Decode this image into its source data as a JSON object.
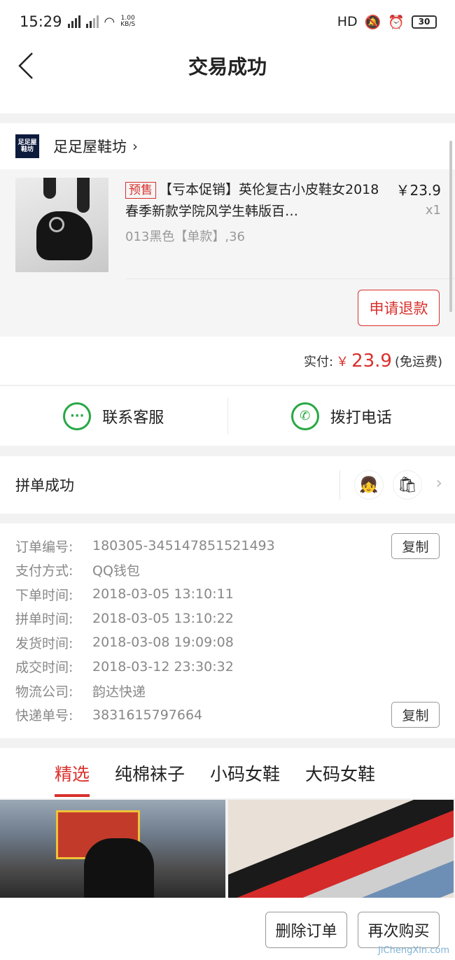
{
  "status_bar": {
    "time": "15:29",
    "net_speed": "1.00\nKB/S",
    "right": "HD",
    "battery": "30"
  },
  "nav": {
    "title": "交易成功"
  },
  "shop": {
    "logo_text": "足足屋\n鞋坊",
    "name": "足足屋鞋坊",
    "item": {
      "tag": "预售",
      "name": "【亏本促销】英伦复古小皮鞋女2018春季新款学院风学生韩版百…",
      "sku": "013黑色【单款】,36",
      "price": "￥23.9",
      "qty": "x1",
      "refund_label": "申请退款"
    }
  },
  "payment": {
    "label": "实付:",
    "currency": "￥",
    "amount": "23.9",
    "note": "(免运费)"
  },
  "contact": {
    "service_label": "联系客服",
    "phone_label": "拨打电话"
  },
  "group": {
    "label": "拼单成功"
  },
  "order_info": {
    "rows": [
      {
        "label": "订单编号:",
        "value": "180305-345147851521493"
      },
      {
        "label": "支付方式:",
        "value": "QQ钱包"
      },
      {
        "label": "下单时间:",
        "value": "2018-03-05 13:10:11"
      },
      {
        "label": "拼单时间:",
        "value": "2018-03-05 13:10:22"
      },
      {
        "label": "发货时间:",
        "value": "2018-03-08 19:09:08"
      },
      {
        "label": "成交时间:",
        "value": "2018-03-12 23:30:32"
      },
      {
        "label": "物流公司:",
        "value": "韵达快递"
      },
      {
        "label": "快递单号:",
        "value": "3831615797664"
      }
    ],
    "copy_label": "复制"
  },
  "tabs": [
    "精选",
    "纯棉袜子",
    "小码女鞋",
    "大码女鞋"
  ],
  "actions": {
    "delete_label": "删除订单",
    "rebuy_label": "再次购买"
  },
  "watermark": "JiChengXin.com",
  "colors": {
    "accent": "#d9302c",
    "green": "#27a844"
  }
}
